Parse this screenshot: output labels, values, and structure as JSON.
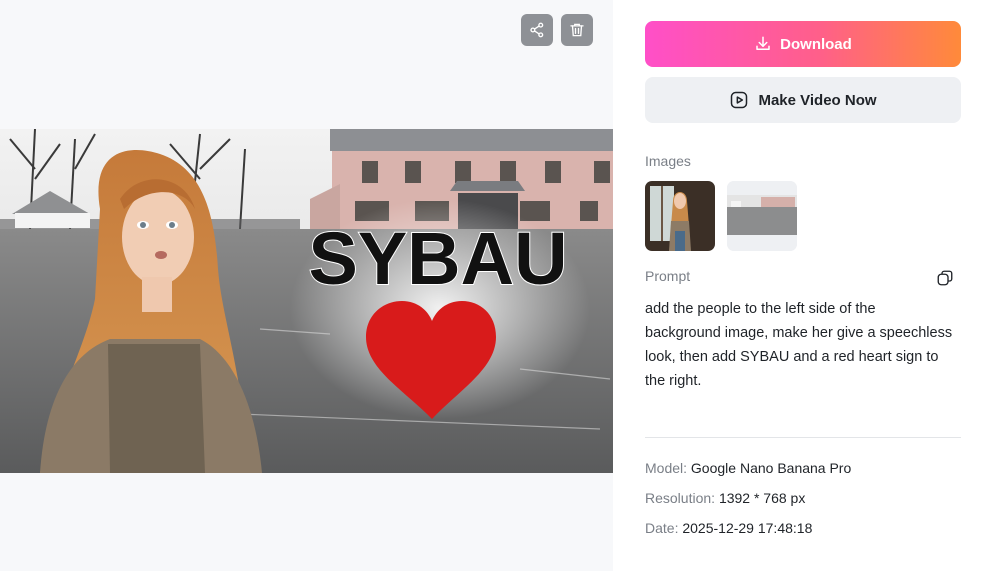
{
  "toolbar": {
    "share_icon": "share-icon",
    "delete_icon": "trash-icon"
  },
  "result": {
    "overlay_text": "SYBAU"
  },
  "actions": {
    "download_label": "Download",
    "make_video_label": "Make Video Now"
  },
  "images": {
    "label": "Images"
  },
  "prompt": {
    "label": "Prompt",
    "text": "add the people to the left side of the background image, make her give a speechless look, then add SYBAU and a red heart sign to the right."
  },
  "details": {
    "model_label": "Model:",
    "model_value": "Google Nano Banana Pro",
    "resolution_label": "Resolution:",
    "resolution_value": "1392 * 768 px",
    "date_label": "Date:",
    "date_value": "2025-12-29 17:48:18"
  },
  "colors": {
    "download_gradient_start": "#ff4fc8",
    "download_gradient_end": "#ff8a3a",
    "heart": "#d81b1b"
  }
}
